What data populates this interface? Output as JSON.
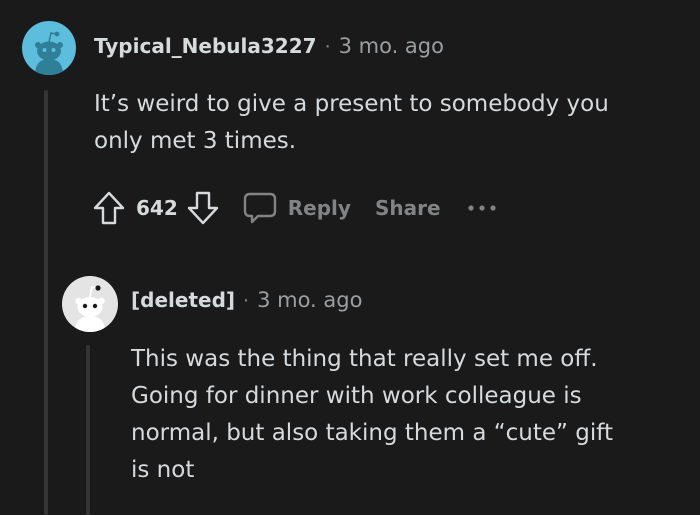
{
  "comment": {
    "username": "Typical_Nebula3227",
    "separator": "·",
    "timestamp": "3 mo. ago",
    "body_lines": [
      "It’s weird to give a present to somebody you",
      "only met 3 times."
    ],
    "score": "642",
    "actions": {
      "reply_label": "Reply",
      "share_label": "Share",
      "upvote_icon": "arrow-up-outline-icon",
      "downvote_icon": "arrow-down-outline-icon",
      "reply_icon": "speech-bubble-icon",
      "more_icon": "ellipsis-icon"
    },
    "avatar": {
      "icon": "snoo-avatar-icon",
      "background": "#5cbddc"
    }
  },
  "reply": {
    "username": "[deleted]",
    "separator": "·",
    "timestamp": "3 mo. ago",
    "body_lines": [
      "This was the thing that really set me off.",
      "Going for dinner with work colleague is",
      "normal, but also taking them a “cute” gift",
      "is not"
    ],
    "avatar": {
      "icon": "snoo-avatar-icon",
      "background": "#e4e4e4"
    }
  },
  "colors": {
    "background": "#1a1a1b",
    "text": "#d7dadc",
    "muted": "#818384",
    "thread_line": "#343536"
  }
}
